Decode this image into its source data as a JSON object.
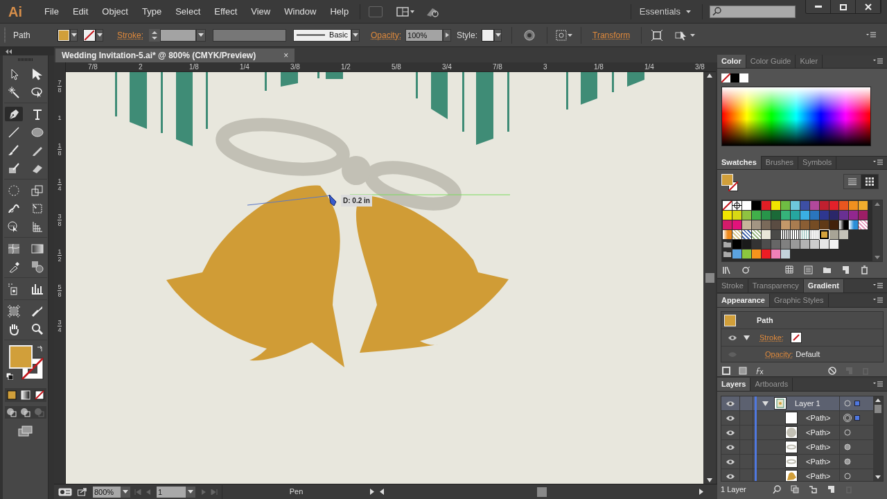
{
  "app": {
    "logo": "Ai",
    "menu": [
      "File",
      "Edit",
      "Object",
      "Type",
      "Select",
      "Effect",
      "View",
      "Window",
      "Help"
    ],
    "workspace": "Essentials"
  },
  "control_bar": {
    "selection": "Path",
    "fill": {
      "color": "#d19f3a"
    },
    "stroke_label": "Stroke:",
    "brush": "Basic",
    "opacity_label": "Opacity:",
    "opacity": "100%",
    "style_label": "Style:",
    "transform": "Transform"
  },
  "document": {
    "tab": "Wedding Invitation-5.ai* @ 800% (CMYK/Preview)",
    "tab_close": "×",
    "measure": "D: 0.2 in",
    "ruler_h": [
      "7/8",
      "2",
      "1/8",
      "1/4",
      "3/8",
      "1/2",
      "5/8",
      "3/4",
      "7/8",
      "3",
      "1/8",
      "1/4",
      "3/8"
    ],
    "ruler_v": [
      {
        "num": "7",
        "den": "8"
      },
      {
        "num": "1"
      },
      {
        "num": "1",
        "den": "8"
      },
      {
        "num": "1",
        "den": "4"
      },
      {
        "num": "3",
        "den": "8"
      },
      {
        "num": "1",
        "den": "2"
      },
      {
        "num": "5",
        "den": "8"
      },
      {
        "num": "3",
        "den": "4"
      }
    ]
  },
  "tools": [
    [
      {
        "kind": "selection",
        "selected": false
      },
      {
        "kind": "direct-selection",
        "selected": false
      },
      {
        "kind": "magic-wand",
        "selected": false
      },
      {
        "kind": "lasso",
        "selected": false
      }
    ],
    [
      {
        "kind": "pen",
        "selected": true
      },
      {
        "kind": "type",
        "selected": false
      },
      {
        "kind": "line",
        "selected": false
      },
      {
        "kind": "ellipse",
        "selected": false
      },
      {
        "kind": "brush",
        "selected": false
      },
      {
        "kind": "pencil",
        "selected": false
      },
      {
        "kind": "blob-brush",
        "selected": false
      },
      {
        "kind": "eraser",
        "selected": false
      }
    ],
    [
      {
        "kind": "rotate",
        "selected": false
      },
      {
        "kind": "scale",
        "selected": false
      },
      {
        "kind": "puppet",
        "selected": false
      },
      {
        "kind": "free-transform",
        "selected": false
      },
      {
        "kind": "shape-builder",
        "selected": false
      },
      {
        "kind": "perspective",
        "selected": false
      }
    ],
    [
      {
        "kind": "mesh",
        "selected": false
      },
      {
        "kind": "gradient",
        "selected": false
      },
      {
        "kind": "eyedropper",
        "selected": false
      },
      {
        "kind": "blend",
        "selected": false
      }
    ],
    [
      {
        "kind": "spray",
        "selected": false
      },
      {
        "kind": "graph",
        "selected": false
      }
    ],
    [
      {
        "kind": "artboard",
        "selected": false
      },
      {
        "kind": "slice",
        "selected": false
      },
      {
        "kind": "hand",
        "selected": false
      },
      {
        "kind": "zoom",
        "selected": false
      }
    ]
  ],
  "fill_stroke": {
    "fill": {
      "color": "#d19f3a"
    }
  },
  "panels": {
    "color": {
      "tabs": [
        {
          "label": "Color",
          "selected": true
        },
        {
          "label": "Color Guide",
          "selected": false
        },
        {
          "label": "Kuler",
          "selected": false
        }
      ]
    },
    "swatches": {
      "tabs": [
        {
          "label": "Swatches",
          "selected": true
        },
        {
          "label": "Brushes",
          "selected": false
        },
        {
          "label": "Symbols",
          "selected": false
        }
      ],
      "fill": {
        "color": "#d19f3a"
      },
      "grid_view": true,
      "rows": [
        [
          {
            "kind": "none",
            "selected": false
          },
          {
            "kind": "registration",
            "selected": false
          },
          {
            "kind": "solid",
            "color": "#ffffff",
            "selected": false
          },
          {
            "kind": "solid",
            "color": "#000000",
            "selected": false
          },
          {
            "kind": "solid",
            "color": "#e01e25",
            "selected": false
          },
          {
            "kind": "solid",
            "color": "#f2e500",
            "selected": false
          },
          {
            "kind": "solid",
            "color": "#6fbd43",
            "selected": false
          },
          {
            "kind": "solid",
            "color": "#6dc8dc",
            "selected": false
          },
          {
            "kind": "solid",
            "color": "#3d4fa3",
            "selected": false
          },
          {
            "kind": "solid",
            "color": "#b1489b",
            "selected": false
          },
          {
            "kind": "solid",
            "color": "#c0202f",
            "selected": false
          },
          {
            "kind": "solid",
            "color": "#e3212a",
            "selected": false
          },
          {
            "kind": "solid",
            "color": "#e8561f",
            "selected": false
          },
          {
            "kind": "solid",
            "color": "#f0901f",
            "selected": false
          },
          {
            "kind": "solid",
            "color": "#f2ad2e",
            "selected": false
          }
        ],
        [
          {
            "kind": "solid",
            "color": "#f3e600",
            "selected": false
          },
          {
            "kind": "solid",
            "color": "#d8d914",
            "selected": false
          },
          {
            "kind": "solid",
            "color": "#8fc341",
            "selected": false
          },
          {
            "kind": "solid",
            "color": "#41b04a",
            "selected": false
          },
          {
            "kind": "solid",
            "color": "#28954a",
            "selected": false
          },
          {
            "kind": "solid",
            "color": "#1b6a38",
            "selected": false
          },
          {
            "kind": "solid",
            "color": "#35b37a",
            "selected": false
          },
          {
            "kind": "solid",
            "color": "#26a6a0",
            "selected": false
          },
          {
            "kind": "solid",
            "color": "#3aafe4",
            "selected": false
          },
          {
            "kind": "solid",
            "color": "#2a75bd",
            "selected": false
          },
          {
            "kind": "solid",
            "color": "#2e3790",
            "selected": false
          },
          {
            "kind": "solid",
            "color": "#2b2769",
            "selected": false
          },
          {
            "kind": "solid",
            "color": "#693092",
            "selected": false
          },
          {
            "kind": "solid",
            "color": "#92278f",
            "selected": false
          },
          {
            "kind": "solid",
            "color": "#9c1e66",
            "selected": false
          }
        ],
        [
          {
            "kind": "solid",
            "color": "#d41c6a",
            "selected": false
          },
          {
            "kind": "solid",
            "color": "#e2127b",
            "selected": false
          },
          {
            "kind": "solid",
            "color": "#c6b49a",
            "selected": false
          },
          {
            "kind": "solid",
            "color": "#a39583",
            "selected": false
          },
          {
            "kind": "solid",
            "color": "#7a6a5a",
            "selected": false
          },
          {
            "kind": "solid",
            "color": "#5a4c42",
            "selected": false
          },
          {
            "kind": "solid",
            "color": "#c39869",
            "selected": false
          },
          {
            "kind": "solid",
            "color": "#a97c50",
            "selected": false
          },
          {
            "kind": "solid",
            "color": "#8b5e34",
            "selected": false
          },
          {
            "kind": "solid",
            "color": "#754c24",
            "selected": false
          },
          {
            "kind": "solid",
            "color": "#603a17",
            "selected": false
          },
          {
            "kind": "solid",
            "color": "#42210b",
            "selected": false
          },
          {
            "kind": "gradient",
            "color": "#000000",
            "selected": false
          },
          {
            "kind": "gradient",
            "color": "#2a8fd8",
            "selected": false
          },
          {
            "kind": "pattern",
            "color": "#e89ac0",
            "selected": false
          }
        ],
        [
          {
            "kind": "gradient",
            "color": "#f08a1c",
            "selected": false
          },
          {
            "kind": "pattern",
            "color": "#d8c890",
            "selected": false
          },
          {
            "kind": "pattern",
            "color": "#4a6cb0",
            "selected": false
          },
          {
            "kind": "pattern",
            "color": "#9ab880",
            "selected": false
          },
          {
            "kind": "solid",
            "color": "#e8e6d9",
            "selected": false
          },
          {
            "kind": "solid",
            "color": "#4a4a48",
            "selected": false
          },
          {
            "kind": "stripes",
            "color": "#000000",
            "selected": false
          },
          {
            "kind": "stripes",
            "color": "#303030",
            "selected": false
          },
          {
            "kind": "stripes",
            "color": "#7ab0a8",
            "selected": false
          },
          {
            "kind": "stripes",
            "color": "#c0c0c0",
            "selected": false
          },
          {
            "kind": "solid",
            "color": "#d4a23c",
            "selected": true
          },
          {
            "kind": "solid",
            "color": "#a8a496",
            "selected": false
          },
          {
            "kind": "solid",
            "color": "#c4c2b8",
            "selected": false
          }
        ],
        [
          {
            "kind": "folder",
            "selected": false
          },
          {
            "kind": "solid",
            "color": "#000000",
            "selected": false
          },
          {
            "kind": "solid",
            "color": "#1a1a1a",
            "selected": false
          },
          {
            "kind": "solid",
            "color": "#333333",
            "selected": false
          },
          {
            "kind": "solid",
            "color": "#4d4d4d",
            "selected": false
          },
          {
            "kind": "solid",
            "color": "#666666",
            "selected": false
          },
          {
            "kind": "solid",
            "color": "#808080",
            "selected": false
          },
          {
            "kind": "solid",
            "color": "#999999",
            "selected": false
          },
          {
            "kind": "solid",
            "color": "#b3b3b3",
            "selected": false
          },
          {
            "kind": "solid",
            "color": "#cccccc",
            "selected": false
          },
          {
            "kind": "solid",
            "color": "#e6e6e6",
            "selected": false
          },
          {
            "kind": "solid",
            "color": "#f2f2f2",
            "selected": false
          }
        ],
        [
          {
            "kind": "folder",
            "selected": false
          },
          {
            "kind": "solid",
            "color": "#5ba3e0",
            "selected": false
          },
          {
            "kind": "solid",
            "color": "#8cc63f",
            "selected": false
          },
          {
            "kind": "solid",
            "color": "#f7941d",
            "selected": false
          },
          {
            "kind": "solid",
            "color": "#ed1c24",
            "selected": false
          },
          {
            "kind": "solid",
            "color": "#f180b8",
            "selected": false
          },
          {
            "kind": "solid",
            "color": "#c3d3dc",
            "selected": false
          }
        ]
      ]
    },
    "stroke": {
      "tabs": [
        {
          "label": "Stroke",
          "selected": false
        },
        {
          "label": "Transparency",
          "selected": false
        },
        {
          "label": "Gradient",
          "selected": true
        }
      ]
    },
    "appearance": {
      "tabs": [
        {
          "label": "Appearance",
          "selected": true
        },
        {
          "label": "Graphic Styles",
          "selected": false
        }
      ],
      "title": "Path",
      "fill": {
        "color": "#d19f3a"
      },
      "stroke_label": "Stroke:",
      "stroke_expanded": true,
      "opacity_label": "Opacity:",
      "opacity_value": "Default"
    },
    "layers": {
      "tabs": [
        {
          "label": "Layers",
          "selected": true
        },
        {
          "label": "Artboards",
          "selected": false
        }
      ],
      "items": [
        {
          "name": "Layer 1",
          "thumb": {
            "kind": "artboard"
          },
          "expanded": true,
          "selected": true,
          "target": {
            "kind": "ring"
          },
          "children": [
            {
              "name": "<Path>",
              "thumb": {
                "kind": "blank"
              },
              "selected": true,
              "target": {
                "kind": "double"
              }
            },
            {
              "name": "<Path>",
              "thumb": {
                "kind": "circle"
              },
              "selected": false,
              "target": {
                "kind": "ring"
              }
            },
            {
              "name": "<Path>",
              "thumb": {
                "kind": "loop"
              },
              "selected": false,
              "target": {
                "kind": "filled"
              }
            },
            {
              "name": "<Path>",
              "thumb": {
                "kind": "loop"
              },
              "selected": false,
              "target": {
                "kind": "filled"
              }
            },
            {
              "name": "<Path>",
              "thumb": {
                "kind": "bell"
              },
              "selected": false,
              "target": {
                "kind": "ring"
              }
            }
          ]
        }
      ],
      "footer": "1 Layer"
    }
  },
  "status_bar": {
    "zoom": "800%",
    "page": "1",
    "tool": "Pen"
  }
}
